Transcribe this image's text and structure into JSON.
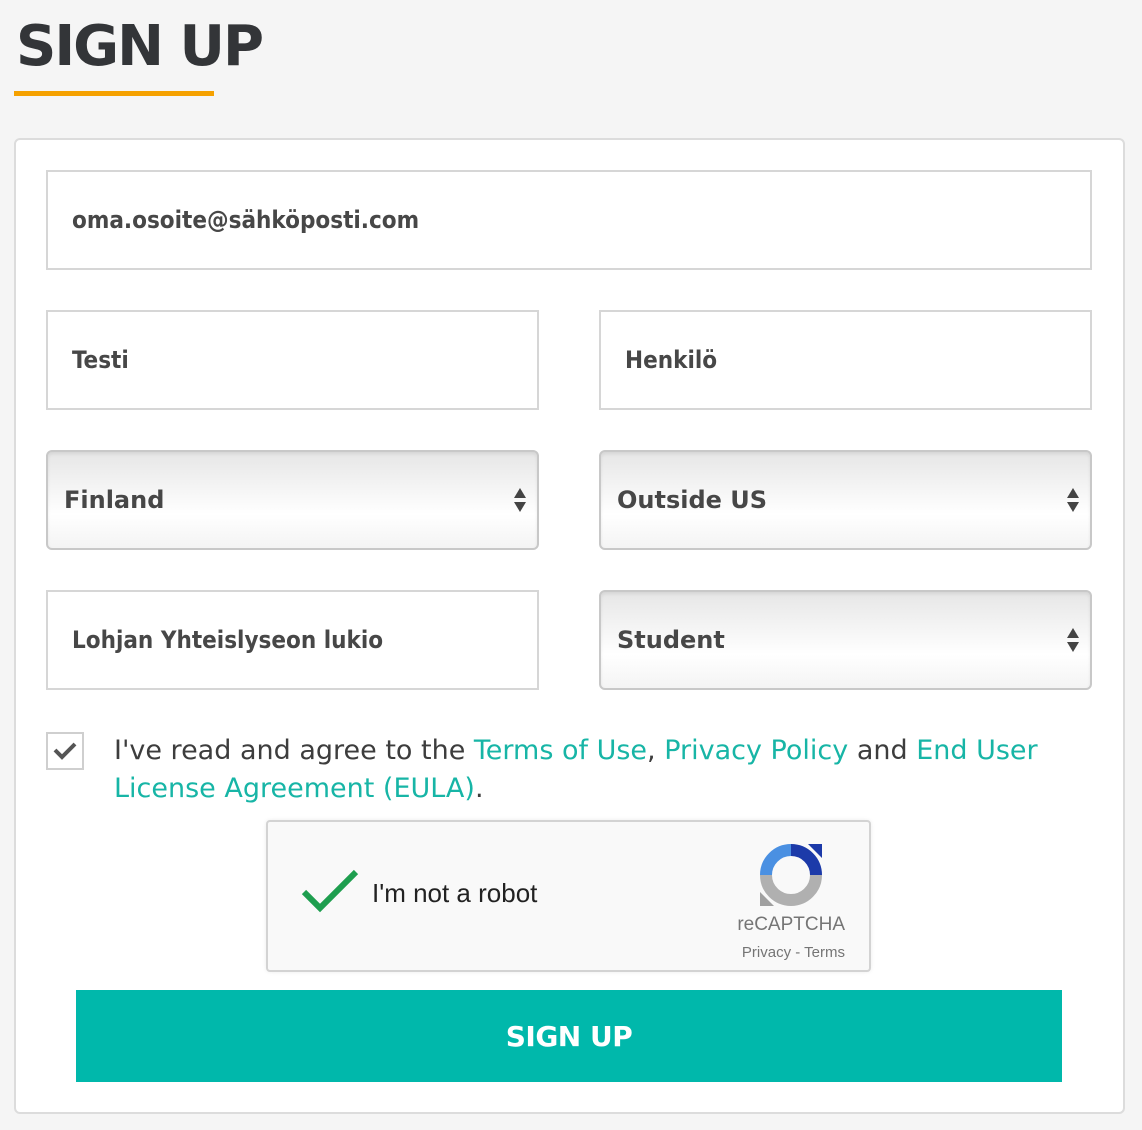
{
  "page": {
    "title": "SIGN UP"
  },
  "form": {
    "email": {
      "value": "oma.osoite@sähköposti.com"
    },
    "first_name": {
      "value": "Testi"
    },
    "last_name": {
      "value": "Henkilö"
    },
    "country": {
      "selected": "Finland"
    },
    "state": {
      "selected": "Outside US"
    },
    "school": {
      "value": "Lohjan Yhteislyseon lukio"
    },
    "role": {
      "selected": "Student"
    },
    "agree": {
      "checked": true,
      "prefix": "I've read and agree to the ",
      "terms_link": "Terms of Use",
      "comma": ", ",
      "privacy_link": "Privacy Policy",
      "and": " and ",
      "eula_link": "End User License Agreement (EULA)",
      "suffix": "."
    },
    "recaptcha": {
      "label": "I'm not a robot",
      "brand": "reCAPTCHA",
      "links": "Privacy - Terms"
    },
    "submit_label": "SIGN UP"
  },
  "colors": {
    "accent_underline": "#f5a100",
    "link": "#17b5a6",
    "button": "#00b8ab"
  }
}
